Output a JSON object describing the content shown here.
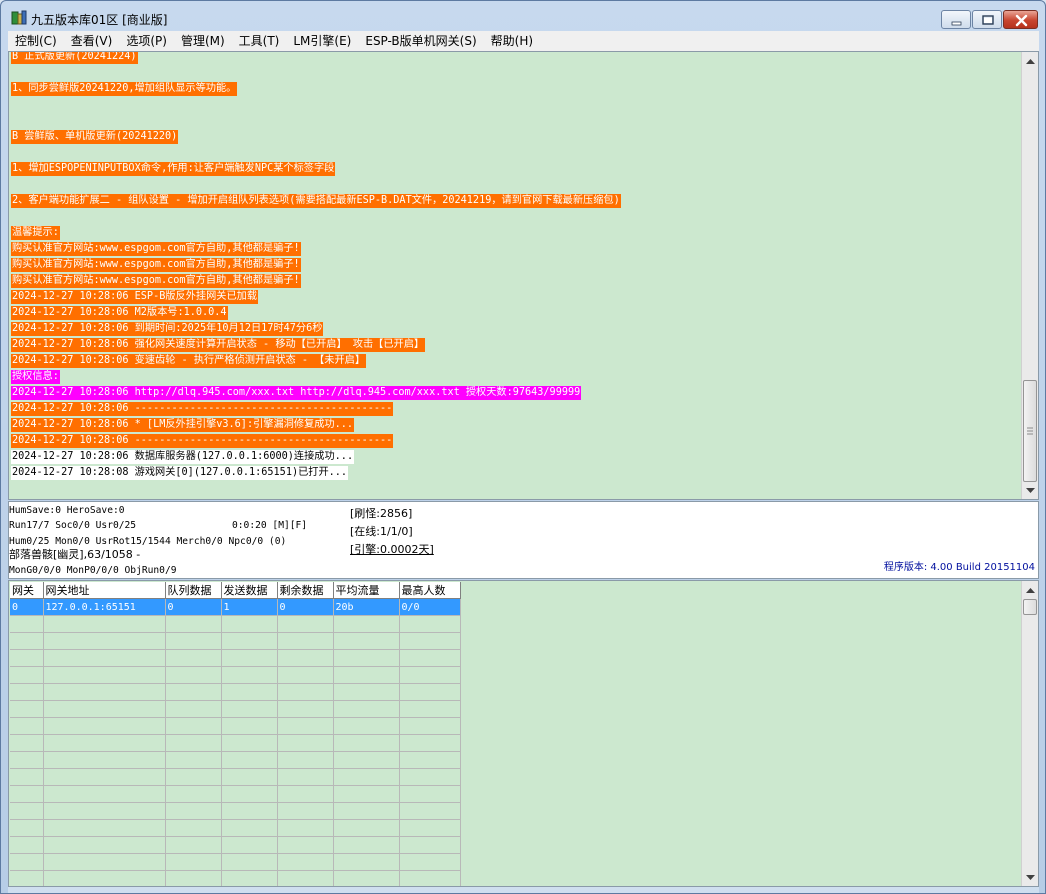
{
  "window": {
    "title": "九五版本库01区 [商业版]"
  },
  "menu": [
    "控制(C)",
    "查看(V)",
    "选项(P)",
    "管理(M)",
    "工具(T)",
    "LM引擎(E)",
    "ESP-B版单机网关(S)",
    "帮助(H)"
  ],
  "log": [
    {
      "text": "B 正式版更新(20241224)",
      "style": "hl"
    },
    {
      "text": "1、同步尝鲜版20241220,增加组队显示等功能。",
      "style": "hl"
    },
    {
      "text": "B 尝鲜版、单机版更新(20241220)",
      "style": "hl"
    },
    {
      "text": "1、增加ESPOPENINPUTBOX命令,作用:让客户端触发NPC某个标签字段",
      "style": "hl"
    },
    {
      "text": "2、客户端功能扩展二 - 组队设置 - 增加开启组队列表选项(需要搭配最新ESP-B.DAT文件，20241219，请到官网下载最新压缩包)",
      "style": "hl"
    },
    {
      "text": "温馨提示:",
      "style": "hl"
    },
    {
      "text": "购买认准官方网站:www.espgom.com官方自助,其他都是骗子!",
      "style": "hl"
    },
    {
      "text": "购买认准官方网站:www.espgom.com官方自助,其他都是骗子!",
      "style": "hl"
    },
    {
      "text": "购买认准官方网站:www.espgom.com官方自助,其他都是骗子!",
      "style": "hl"
    },
    {
      "text": "2024-12-27 10:28:06 ESP-B版反外挂网关已加载",
      "style": "hl"
    },
    {
      "text": "2024-12-27 10:28:06 M2版本号:1.0.0.4",
      "style": "hl"
    },
    {
      "text": "2024-12-27 10:28:06 到期时间:2025年10月12日17时47分6秒",
      "style": "hl"
    },
    {
      "text": "2024-12-27 10:28:06 强化网关速度计算开启状态 - 移动【已开启】 攻击【已开启】",
      "style": "hl"
    },
    {
      "text": "2024-12-27 10:28:06 变速齿轮 - 执行严格侦测开启状态 - 【未开启】",
      "style": "hl"
    },
    {
      "text": "授权信息:",
      "style": "hl-mag"
    },
    {
      "text": "2024-12-27 10:28:06 http://dlq.945.com/xxx.txt http://dlq.945.com/xxx.txt 授权天数:97643/99999",
      "style": "hl-mag"
    },
    {
      "text": "2024-12-27 10:28:06 ------------------------------------------",
      "style": "hl"
    },
    {
      "text": "2024-12-27 10:28:06 * [LM反外挂引擎v3.6]:引擎漏洞修复成功...",
      "style": "hl"
    },
    {
      "text": "2024-12-27 10:28:06 ------------------------------------------",
      "style": "hl"
    },
    {
      "text": "2024-12-27 10:28:06 数据库服务器(127.0.0.1:6000)连接成功...",
      "style": "hl-white"
    },
    {
      "text": "2024-12-27 10:28:08 游戏网关[0](127.0.0.1:65151)已打开...",
      "style": "hl-white"
    }
  ],
  "status": {
    "humsave": "HumSave:0 HeroSave:0",
    "run": "Run17/7 Soc0/0 Usr0/25",
    "timer": "0:0:20 [M][F]",
    "hum": "Hum0/25 Mon0/0 UsrRot15/1544 Merch0/0 Npc0/0 (0)",
    "monster": "部落兽骸[幽灵],63/1058 -",
    "mongo": "MonG0/0/0 MonP0/0/0 ObjRun0/9",
    "refresh": "[刷怪:2856]",
    "online": "[在线:1/1/0]",
    "engine": "[引擎:0.0002天]",
    "version": "程序版本: 4.00 Build 20151104"
  },
  "grid": {
    "columns": [
      "网关",
      "网关地址",
      "队列数据",
      "发送数据",
      "剩余数据",
      "平均流量",
      "最高人数"
    ],
    "rows": [
      [
        "0",
        "127.0.0.1:65151",
        "0",
        "1",
        "0",
        "20b",
        "0/0"
      ]
    ],
    "empty_rows": 16
  },
  "colors": {
    "log_bg": "#cce8cf",
    "highlight_orange": "#ff6f00",
    "highlight_magenta": "#ff00ff",
    "selection": "#3399ff",
    "version_text": "#000f9e"
  }
}
